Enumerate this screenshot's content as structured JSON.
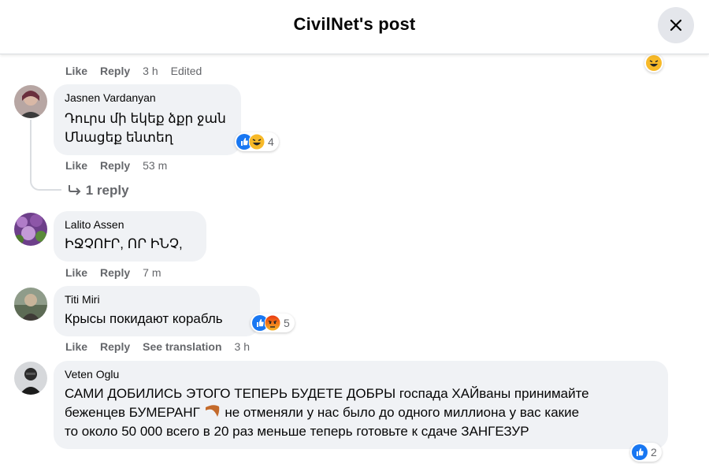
{
  "header": {
    "title": "CivilNet's post",
    "close_icon": "close-icon"
  },
  "actions_labels": {
    "like": "Like",
    "reply": "Reply",
    "see_translation": "See translation"
  },
  "top_comment": {
    "time": "3 h",
    "edited": "Edited",
    "reaction": "haha"
  },
  "comments": [
    {
      "author": "Jasnen Vardanyan",
      "lines": [
        "Դուրս մի եկեք ձքր ջան",
        "Մնացեք ենտեղ"
      ],
      "time": "53 m",
      "reactions": [
        "like",
        "haha"
      ],
      "reaction_count": "4",
      "replies": "1 reply"
    },
    {
      "author": "Lalito Assen",
      "lines": [
        "ԻՋՉՈՒՐ, ՈՐ ԻՆՉ,"
      ],
      "time": "7 m"
    },
    {
      "author": "Titi Miri",
      "lines": [
        "Крысы покидают корабль"
      ],
      "time": "3 h",
      "reactions": [
        "like",
        "angry"
      ],
      "reaction_count": "5"
    },
    {
      "author": "Veten Oglu",
      "lines": [
        "САМИ ДОБИЛИСЬ ЭТОГО ТЕПЕРЬ БУДЕТЕ ДОБРЫ госпада ХАЙваны принимайте",
        "беженцев БУМЕРАНГ",
        "не отменяли у нас было до одного миллиона у вас какие",
        "то около 50 000 всего в 20 раз меньше теперь готовьте к сдаче ЗАНГЕЗУР"
      ],
      "reaction_count": "2"
    }
  ],
  "colors": {
    "bubble": "#f0f2f5",
    "meta": "#65676b",
    "like_blue": "#1877f2",
    "haha_yellow": "#f7b928",
    "angry_orange": "#e9710f"
  }
}
